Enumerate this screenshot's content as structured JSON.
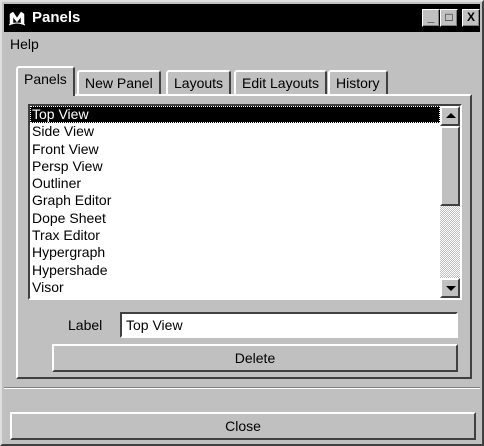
{
  "window": {
    "title": "Panels",
    "icon": "maya-logo-icon",
    "controls": {
      "minimize": "_",
      "maximize": "□",
      "close": "X"
    }
  },
  "menubar": {
    "items": [
      "Help"
    ]
  },
  "tabs": [
    {
      "label": "Panels",
      "active": true
    },
    {
      "label": "New Panel",
      "active": false
    },
    {
      "label": "Layouts",
      "active": false
    },
    {
      "label": "Edit Layouts",
      "active": false
    },
    {
      "label": "History",
      "active": false
    }
  ],
  "panel_list": {
    "items": [
      "Top View",
      "Side View",
      "Front View",
      "Persp View",
      "Outliner",
      "Graph Editor",
      "Dope Sheet",
      "Trax Editor",
      "Hypergraph",
      "Hypershade",
      "Visor"
    ],
    "selected": "Top View"
  },
  "label_field": {
    "label": "Label",
    "value": "Top View"
  },
  "buttons": {
    "delete": "Delete",
    "close": "Close"
  },
  "colors": {
    "face": "#c0c0c0",
    "titlebar": "#000000",
    "selection": "#000000"
  }
}
